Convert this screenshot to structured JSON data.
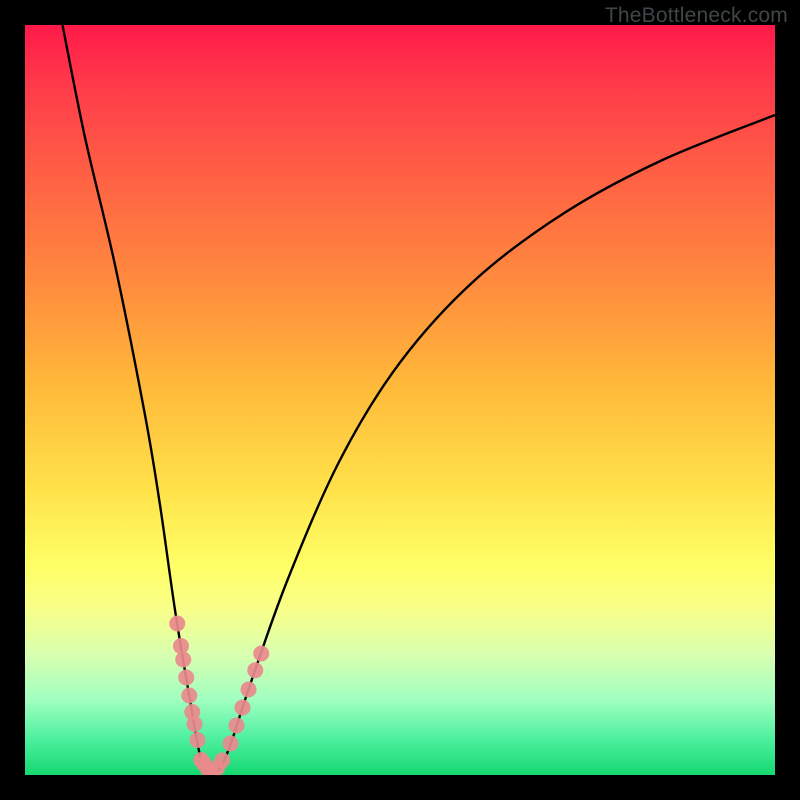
{
  "watermark": "TheBottleneck.com",
  "chart_data": {
    "type": "line",
    "title": "",
    "xlabel": "",
    "ylabel": "",
    "xlim": [
      0,
      100
    ],
    "ylim": [
      0,
      100
    ],
    "series": [
      {
        "name": "bottleneck-curve",
        "x": [
          5,
          8,
          12,
          16,
          18,
          20,
          22,
          23.5,
          25,
          27,
          30,
          35,
          42,
          50,
          60,
          72,
          85,
          100
        ],
        "y": [
          100,
          85,
          68,
          48,
          36,
          22,
          10,
          2,
          0,
          3,
          12,
          26,
          42,
          55,
          66,
          75,
          82,
          88
        ]
      }
    ],
    "highlight_markers": {
      "name": "pink-dots",
      "note": "clustered near the dip of the curve",
      "color": "#e98a8d",
      "x": [
        20.3,
        20.8,
        21.1,
        21.5,
        21.9,
        22.3,
        22.6,
        23.0,
        23.5,
        23.9,
        24.4,
        24.9,
        25.6,
        26.3,
        27.4,
        28.2,
        29.0,
        29.8,
        30.7,
        31.5
      ],
      "y_from_curve": true
    },
    "colors": {
      "curve": "#000000",
      "marker": "#e98a8d",
      "gradient_top": "#ff1a4a",
      "gradient_bottom": "#14d870",
      "frame": "#000000"
    }
  }
}
